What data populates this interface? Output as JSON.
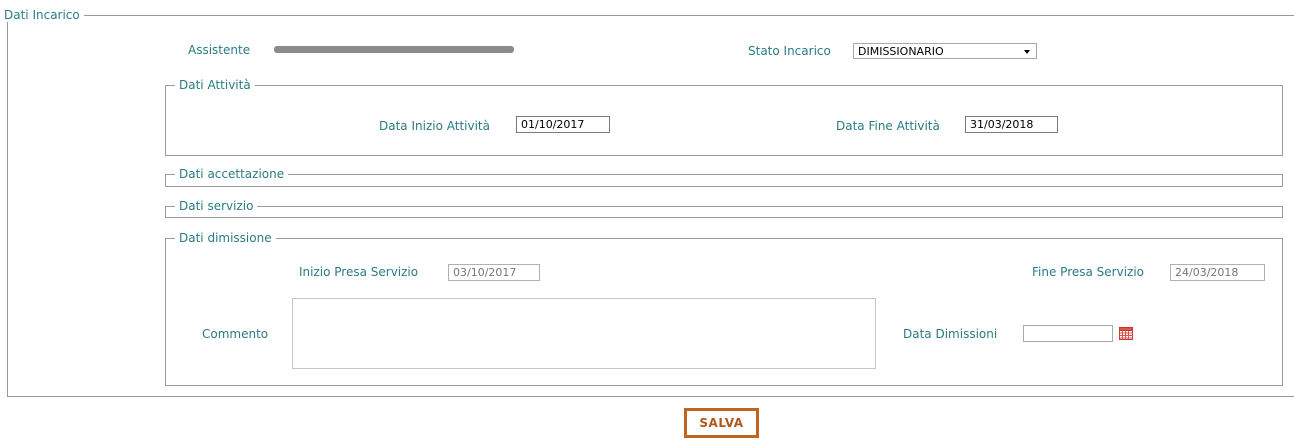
{
  "dati_incarico": {
    "legend": "Dati Incarico",
    "assistente_label": "Assistente",
    "stato_label": "Stato Incarico",
    "stato_value": "DIMISSIONARIO"
  },
  "dati_attivita": {
    "legend": "Dati Attività",
    "inizio_label": "Data Inizio Attività",
    "inizio_value": "01/10/2017",
    "fine_label": "Data Fine Attività",
    "fine_value": "31/03/2018"
  },
  "dati_accettazione": {
    "legend": "Dati accettazione"
  },
  "dati_servizio": {
    "legend": "Dati servizio"
  },
  "dati_dimissione": {
    "legend": "Dati dimissione",
    "inizio_presa_label": "Inizio Presa Servizio",
    "inizio_presa_value": "03/10/2017",
    "fine_presa_label": "Fine Presa Servizio",
    "fine_presa_value": "24/03/2018",
    "commento_label": "Commento",
    "commento_value": "",
    "data_dimissioni_label": "Data Dimissioni",
    "data_dimissioni_value": ""
  },
  "actions": {
    "save_label": "SALVA"
  },
  "icons": {
    "calendar": "calendar-icon",
    "dropdown": "chevron-down-icon"
  },
  "colors": {
    "label": "#2a7b86",
    "button_border": "#c0651e",
    "button_text": "#b2571a",
    "border": "#9a9a9a"
  }
}
